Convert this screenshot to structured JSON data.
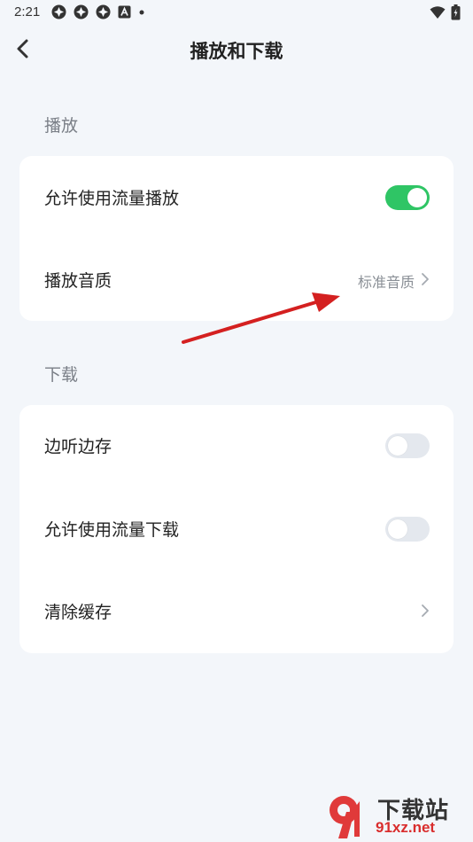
{
  "status_bar": {
    "time": "2:21",
    "left_icons": [
      "app-notification-icon",
      "app-notification-icon",
      "app-notification-icon",
      "a-box-icon",
      "dot-icon"
    ],
    "right_icons": [
      "wifi-icon",
      "battery-icon"
    ]
  },
  "header": {
    "title": "播放和下载",
    "back_icon": "chevron-left-icon"
  },
  "sections": {
    "playback": {
      "label": "播放",
      "allow_data_play": {
        "label": "允许使用流量播放",
        "enabled": true
      },
      "audio_quality": {
        "label": "播放音质",
        "value": "标准音质"
      }
    },
    "download": {
      "label": "下载",
      "play_and_cache": {
        "label": "边听边存",
        "enabled": false
      },
      "allow_data_download": {
        "label": "允许使用流量下载",
        "enabled": false
      },
      "clear_cache": {
        "label": "清除缓存"
      }
    }
  },
  "colors": {
    "toggle_on": "#2fc565",
    "toggle_off": "#e4e8ee",
    "background": "#f3f6fa",
    "annotation": "#d42020"
  },
  "watermark": {
    "logo_text": "9",
    "title": "下载站",
    "url": "91xz.net"
  }
}
